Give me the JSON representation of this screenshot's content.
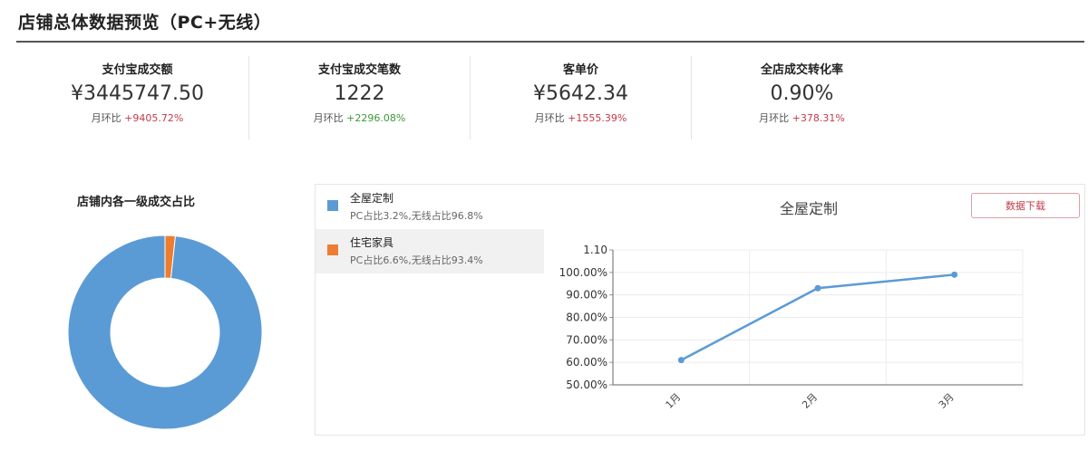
{
  "page": {
    "title": "店铺总体数据预览（PC+无线）"
  },
  "kpis": [
    {
      "label": "支付宝成交额",
      "value": "¥3445747.50",
      "change_prefix": "月环比",
      "change": "+9405.72%",
      "change_color": "#c23b4a"
    },
    {
      "label": "支付宝成交笔数",
      "value": "1222",
      "change_prefix": "月环比",
      "change": "+2296.08%",
      "change_color": "#3a9a3a"
    },
    {
      "label": "客单价",
      "value": "¥5642.34",
      "change_prefix": "月环比",
      "change": "+1555.39%",
      "change_color": "#c23b4a"
    },
    {
      "label": "全店成交转化率",
      "value": "0.90%",
      "change_prefix": "月环比",
      "change": "+378.31%",
      "change_color": "#c23b4a"
    }
  ],
  "donut": {
    "title": "店铺内各一级成交占比",
    "slices": [
      {
        "name": "全屋定制",
        "percent": 98.3,
        "color": "#5b9bd5"
      },
      {
        "name": "住宅家具",
        "percent": 1.7,
        "color": "#ed7d31"
      }
    ]
  },
  "category_list": [
    {
      "name": "全屋定制",
      "desc": "PC占比3.2%,无线占比96.8%",
      "color": "#5b9bd5",
      "active": false
    },
    {
      "name": "住宅家具",
      "desc": "PC占比6.6%,无线占比93.4%",
      "color": "#ed7d31",
      "active": true
    }
  ],
  "line_panel": {
    "title": "全屋定制",
    "download_label": "数据下载"
  },
  "chart_data": {
    "type": "line",
    "title": "全屋定制",
    "categories": [
      "1月",
      "2月",
      "3月"
    ],
    "series": [
      {
        "values": [
          0.61,
          0.93,
          0.99
        ],
        "color": "#5b9bd5"
      }
    ],
    "y_ticks": [
      "50.00%",
      "60.00%",
      "70.00%",
      "80.00%",
      "90.00%",
      "100.00%",
      "1.10"
    ],
    "ylim": [
      0.5,
      1.1
    ],
    "grid": true,
    "xlabel": "",
    "ylabel": ""
  }
}
